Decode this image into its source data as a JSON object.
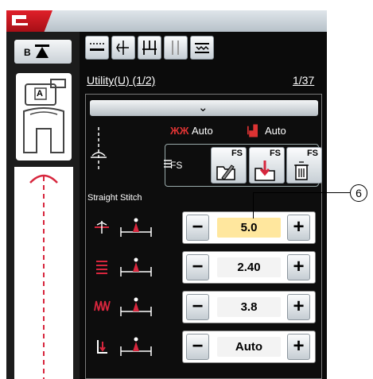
{
  "header": {
    "title": "Utility(U) (1/2)",
    "page_indicator": "1/37"
  },
  "presser_foot": {
    "tab_label": "B",
    "foot_letter": "A"
  },
  "mode_buttons": [
    "mode-stitch-a",
    "mode-stitch-b",
    "mode-stitch-c",
    "mode-stitch-d",
    "mode-stitch-e"
  ],
  "collapse": {
    "chevron": "⌄"
  },
  "auto_settings": {
    "thread_label": "Auto",
    "feed_label": "Auto"
  },
  "fs": {
    "label": "FS",
    "buttons": [
      "FS",
      "FS",
      "FS"
    ]
  },
  "stitch_name": "Straight Stitch",
  "steppers": [
    {
      "name": "width",
      "value": "5.0",
      "highlighted": true
    },
    {
      "name": "length",
      "value": "2.40",
      "highlighted": false
    },
    {
      "name": "tension",
      "value": "3.8",
      "highlighted": false
    },
    {
      "name": "foot-pressure",
      "value": "Auto",
      "highlighted": false
    }
  ],
  "stepper_minus": "−",
  "stepper_plus": "+",
  "callout": "6",
  "colors": {
    "accent_red": "#d7263d",
    "highlight": "#ffe79e"
  }
}
